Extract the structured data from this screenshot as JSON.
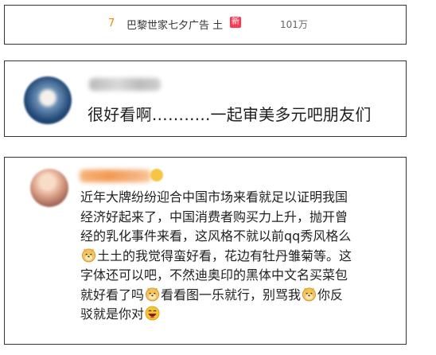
{
  "trending": {
    "rank": "7",
    "topic": "巴黎世家七夕广告 土",
    "badge": "新",
    "heat": "101万"
  },
  "comment_1": {
    "text": "很好看啊………..一起审美多元吧朋友们"
  },
  "comment_2": {
    "lines": [
      [
        "近年大牌纷纷迎合中国市场来看就足以证明我国"
      ],
      [
        "经济好起来了，中国消费者购买力上升，抛开曾"
      ],
      [
        "经的乳化事件来看，这风格不就以前qq秀风格么"
      ],
      [
        "土土的我觉得蛮好看，花边有牡丹雏菊等。这"
      ],
      [
        "字体还可以吧，不然迪奥印的黑体中文名买菜包"
      ],
      [
        "就好看了吗",
        "看看图一乐就行，别骂我",
        "你反"
      ],
      [
        "驳就是你对"
      ]
    ],
    "emojis": [
      "doge-emoji",
      "doge-emoji",
      "doge-emoji",
      "laughing-emoji"
    ]
  }
}
